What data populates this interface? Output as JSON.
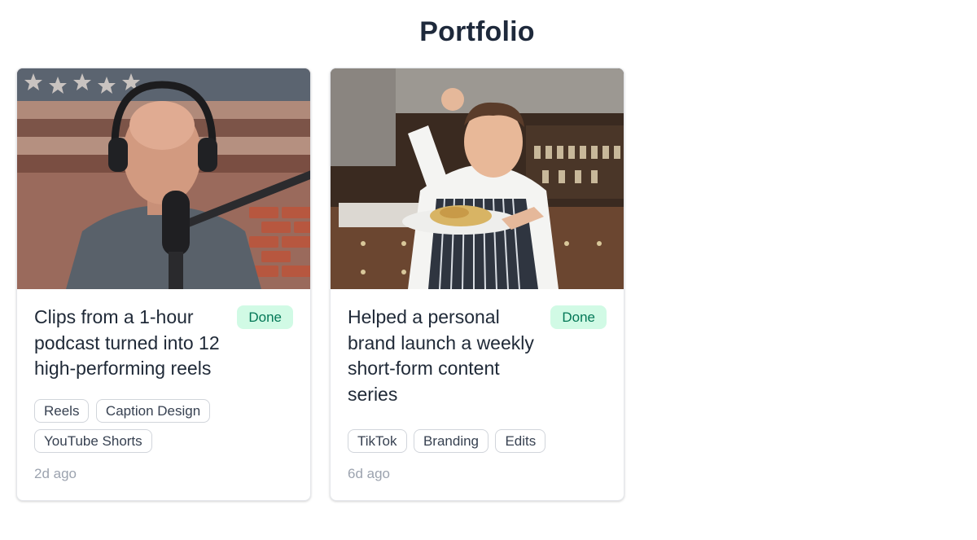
{
  "page": {
    "title": "Portfolio"
  },
  "cards": [
    {
      "title": "Clips from a 1-hour podcast turned into 12 high-performing reels",
      "status": "Done",
      "tags": [
        "Reels",
        "Caption Design",
        "YouTube Shorts"
      ],
      "time": "2d ago",
      "image": "podcast-host-with-headphones-and-microphone"
    },
    {
      "title": "Helped a personal brand launch a weekly short-form content series",
      "status": "Done",
      "tags": [
        "TikTok",
        "Branding",
        "Edits"
      ],
      "time": "6d ago",
      "image": "chef-holding-plate-of-pasta-in-kitchen"
    }
  ],
  "colors": {
    "badge_bg": "#d1fae5",
    "badge_text": "#047857",
    "title": "#1e293b",
    "muted": "#9ca3af"
  }
}
